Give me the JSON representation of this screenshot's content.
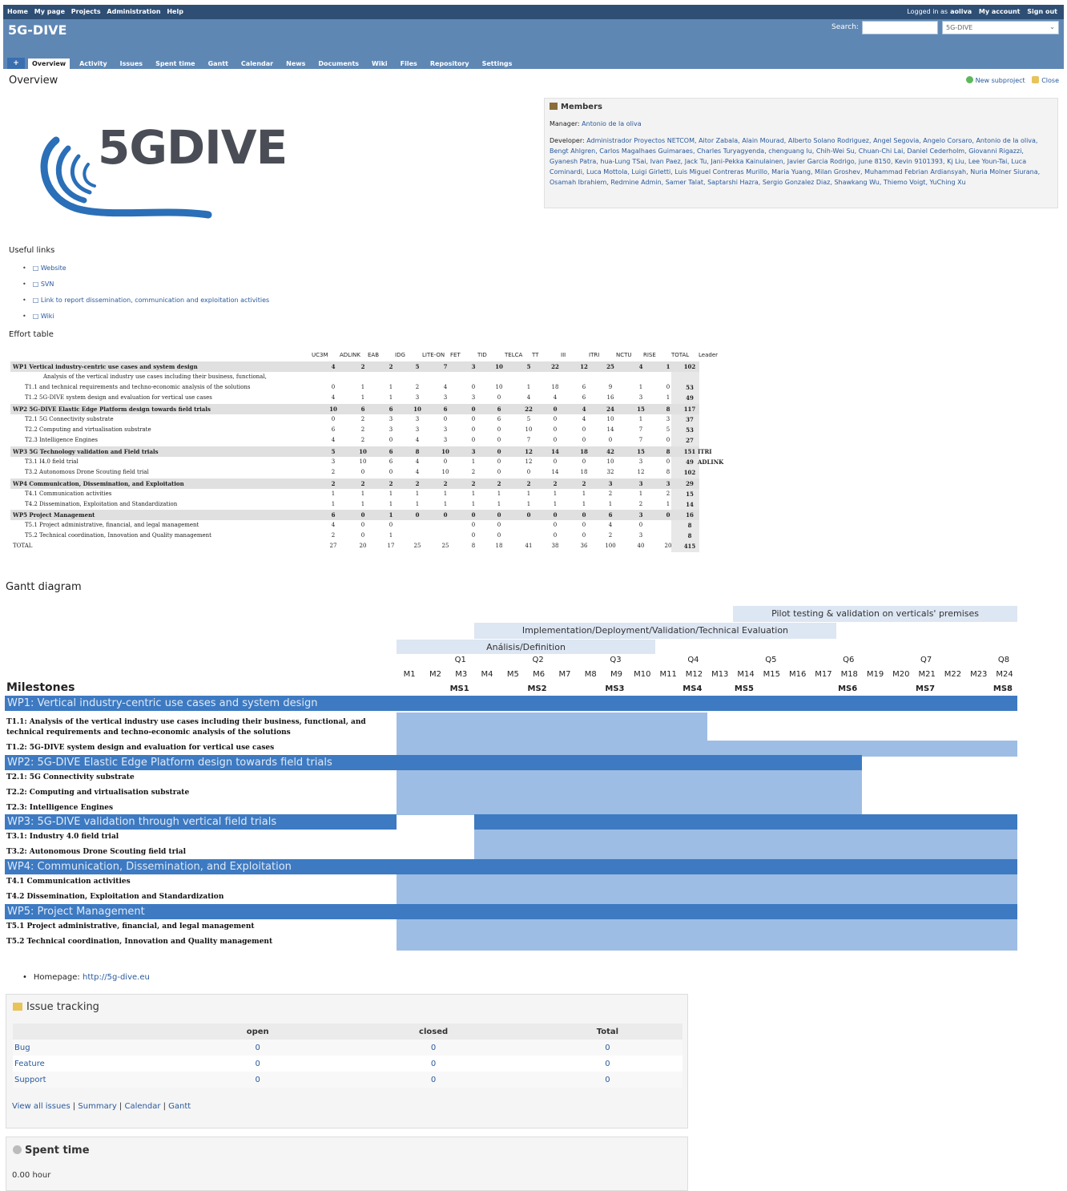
{
  "top_menu": {
    "items": [
      "Home",
      "My page",
      "Projects",
      "Administration",
      "Help"
    ],
    "logged_in_prefix": "Logged in as",
    "user": "aoliva",
    "my_account": "My account",
    "sign_out": "Sign out"
  },
  "header": {
    "title": "5G-DIVE",
    "search_label": "Search:",
    "jump_value": "5G-DIVE"
  },
  "tabs": [
    "Overview",
    "Activity",
    "Issues",
    "Spent time",
    "Gantt",
    "Calendar",
    "News",
    "Documents",
    "Wiki",
    "Files",
    "Repository",
    "Settings"
  ],
  "tab_new": "+",
  "page": {
    "title": "Overview",
    "new_subproject": "New subproject",
    "close": "Close"
  },
  "logo": {
    "text": "5GDIVE"
  },
  "members": {
    "title": "Members",
    "manager_label": "Manager:",
    "manager": "Antonio de la oliva",
    "developer_label": "Developer:",
    "developers": "Administrador Proyectos NETCOM, Aitor Zabala, Alain Mourad, Alberto Solano Rodriguez, Angel Segovia, Angelo Corsaro, Antonio de la oliva, Bengt Ahlgren, Carlos Magalhaes Guimaraes, Charles Turyagyenda, chenguang lu, Chih-Wei Su, Chuan-Chi Lai, Daniel Cederholm, Giovanni Rigazzi, Gyanesh Patra, hua-Lung TSai, Ivan Paez, Jack Tu, Jani-Pekka Kainulainen, Javier Garcia Rodrigo, june 8150, Kevin 9101393, Kj Liu, Lee Youn-Tai, Luca Cominardi, Luca Mottola, Luigi Girletti, Luis Miguel Contreras Murillo, Maria Yuang, Milan Groshev, Muhammad Febrian Ardiansyah, Nuria Molner Siurana, Osamah Ibrahiem, Redmine Admin, Samer Talat, Saptarshi Hazra, Sergio Gonzalez Diaz, Shawkang Wu, Thiemo Voigt, YuChing Xu"
  },
  "useful_links": {
    "title": "Useful links",
    "items": [
      "Website",
      "SVN",
      "Link to report dissemination, communication and exploitation activities",
      "Wiki"
    ]
  },
  "effort": {
    "title": "Effort table",
    "headers": [
      "UC3M",
      "ADLINK",
      "EAB",
      "IDG",
      "LITE-ON",
      "FET",
      "TID",
      "TELCA",
      "TT",
      "III",
      "ITRI",
      "NCTU",
      "RISE",
      "TOTAL",
      "Leader"
    ],
    "rows": [
      {
        "label": "WP1 Vertical industry-centric use cases and system design",
        "vals": [
          "4",
          "2",
          "2",
          "5",
          "7",
          "3",
          "10",
          "5",
          "22",
          "12",
          "25",
          "4",
          "1",
          "102"
        ],
        "leader": "",
        "wp": true
      },
      {
        "label": "Analysis of the vertical industry use cases including their business, functional,",
        "vals": [],
        "leader": "",
        "wp": false
      },
      {
        "label": "T1.1 and technical requirements and techno-economic analysis of the solutions",
        "vals": [
          "0",
          "1",
          "1",
          "2",
          "4",
          "0",
          "10",
          "1",
          "18",
          "6",
          "9",
          "1",
          "0",
          "53"
        ],
        "leader": "",
        "wp": false
      },
      {
        "label": "T1.2 5G-DIVE system design and evaluation for vertical use cases",
        "vals": [
          "4",
          "1",
          "1",
          "3",
          "3",
          "3",
          "0",
          "4",
          "4",
          "6",
          "16",
          "3",
          "1",
          "49"
        ],
        "leader": "",
        "wp": false
      },
      {
        "label": "WP2 5G-DIVE Elastic Edge Platform design towards field trials",
        "vals": [
          "10",
          "6",
          "6",
          "10",
          "6",
          "0",
          "6",
          "22",
          "0",
          "4",
          "24",
          "15",
          "8",
          "117"
        ],
        "leader": "",
        "wp": true
      },
      {
        "label": "T2.1 5G Connectivity substrate",
        "vals": [
          "0",
          "2",
          "3",
          "3",
          "0",
          "0",
          "6",
          "5",
          "0",
          "4",
          "10",
          "1",
          "3",
          "37"
        ],
        "leader": "",
        "wp": false
      },
      {
        "label": "T2.2 Computing and virtualisation substrate",
        "vals": [
          "6",
          "2",
          "3",
          "3",
          "3",
          "0",
          "0",
          "10",
          "0",
          "0",
          "14",
          "7",
          "5",
          "53"
        ],
        "leader": "",
        "wp": false
      },
      {
        "label": "T2.3 Intelligence Engines",
        "vals": [
          "4",
          "2",
          "0",
          "4",
          "3",
          "0",
          "0",
          "7",
          "0",
          "0",
          "0",
          "7",
          "0",
          "27"
        ],
        "leader": "",
        "wp": false
      },
      {
        "label": "WP3 5G Technology validation and Field trials",
        "vals": [
          "5",
          "10",
          "6",
          "8",
          "10",
          "3",
          "0",
          "12",
          "14",
          "18",
          "42",
          "15",
          "8",
          "151"
        ],
        "leader": "ITRI",
        "wp": true
      },
      {
        "label": "T3.1 I4.0 field trial",
        "vals": [
          "3",
          "10",
          "6",
          "4",
          "0",
          "1",
          "0",
          "12",
          "0",
          "0",
          "10",
          "3",
          "0",
          "49"
        ],
        "leader": "ADLINK",
        "wp": false
      },
      {
        "label": "T3.2 Autonomous Drone Scouting field trial",
        "vals": [
          "2",
          "0",
          "0",
          "4",
          "10",
          "2",
          "0",
          "0",
          "14",
          "18",
          "32",
          "12",
          "8",
          "102"
        ],
        "leader": "",
        "wp": false
      },
      {
        "label": "WP4 Communication, Dissemination, and Exploitation",
        "vals": [
          "2",
          "2",
          "2",
          "2",
          "2",
          "2",
          "2",
          "2",
          "2",
          "2",
          "3",
          "3",
          "3",
          "29"
        ],
        "leader": "",
        "wp": true
      },
      {
        "label": "T4.1 Communication activities",
        "vals": [
          "1",
          "1",
          "1",
          "1",
          "1",
          "1",
          "1",
          "1",
          "1",
          "1",
          "2",
          "1",
          "2",
          "15"
        ],
        "leader": "",
        "wp": false
      },
      {
        "label": "T4.2 Dissemination, Exploitation and Standardization",
        "vals": [
          "1",
          "1",
          "1",
          "1",
          "1",
          "1",
          "1",
          "1",
          "1",
          "1",
          "1",
          "2",
          "1",
          "14"
        ],
        "leader": "",
        "wp": false
      },
      {
        "label": "WP5 Project Management",
        "vals": [
          "6",
          "0",
          "1",
          "0",
          "0",
          "0",
          "0",
          "0",
          "0",
          "0",
          "6",
          "3",
          "0",
          "16"
        ],
        "leader": "",
        "wp": true
      },
      {
        "label": "T5.1 Project administrative, financial, and legal management",
        "vals": [
          "4",
          "0",
          "0",
          "",
          "",
          "0",
          "0",
          "",
          "0",
          "0",
          "4",
          "0",
          "",
          "8"
        ],
        "leader": "",
        "wp": false
      },
      {
        "label": "T5.2 Technical coordination, Innovation and Quality management",
        "vals": [
          "2",
          "0",
          "1",
          "",
          "",
          "0",
          "0",
          "",
          "0",
          "0",
          "2",
          "3",
          "",
          "8"
        ],
        "leader": "",
        "wp": false
      },
      {
        "label": "TOTAL",
        "vals": [
          "27",
          "20",
          "17",
          "25",
          "25",
          "8",
          "18",
          "41",
          "38",
          "36",
          "100",
          "40",
          "20",
          "415"
        ],
        "leader": "",
        "wp": false
      }
    ]
  },
  "gantt": {
    "title": "Gantt diagram",
    "phases": [
      {
        "label": "Pilot testing & validation on verticals' premises",
        "start": 14,
        "end": 24,
        "row": 0
      },
      {
        "label": "Implementation/Deployment/Validation/Technical Evaluation",
        "start": 4,
        "end": 17,
        "row": 1
      },
      {
        "label": "Análisis/Definition",
        "start": 1,
        "end": 10,
        "row": 2
      }
    ],
    "quarters": [
      "Q1",
      "Q2",
      "Q3",
      "Q4",
      "Q5",
      "Q6",
      "Q7",
      "Q8"
    ],
    "months": [
      "M1",
      "M2",
      "M3",
      "M4",
      "M5",
      "M6",
      "M7",
      "M8",
      "M9",
      "M10",
      "M11",
      "M12",
      "M13",
      "M14",
      "M15",
      "M16",
      "M17",
      "M18",
      "M19",
      "M20",
      "M21",
      "M22",
      "M23",
      "M24"
    ],
    "milestones_label": "Milestones",
    "milestones": [
      {
        "label": "MS1",
        "month": 3
      },
      {
        "label": "MS2",
        "month": 6
      },
      {
        "label": "MS3",
        "month": 9
      },
      {
        "label": "MS4",
        "month": 12
      },
      {
        "label": "MS5",
        "month": 14
      },
      {
        "label": "MS6",
        "month": 18
      },
      {
        "label": "MS7",
        "month": 21
      },
      {
        "label": "MS8",
        "month": 24
      }
    ],
    "wps": [
      {
        "label": "WP1: Vertical industry-centric use cases and system design",
        "start": 1,
        "end": 24,
        "tasks": [
          {
            "label": "T1.1: Analysis of the vertical industry use cases including their business, functional, and technical requirements and techno-economic analysis of the solutions",
            "start": 1,
            "end": 12
          },
          {
            "label": "T1.2: 5G-DIVE system design and evaluation for vertical use cases",
            "start": 1,
            "end": 24
          }
        ]
      },
      {
        "label": "WP2: 5G-DIVE Elastic Edge Platform design towards field trials",
        "start": 1,
        "end": 18,
        "tasks": [
          {
            "label": "T2.1: 5G Connectivity substrate",
            "start": 1,
            "end": 18
          },
          {
            "label": "T2.2: Computing and virtualisation substrate",
            "start": 1,
            "end": 18
          },
          {
            "label": "T2.3: Intelligence Engines",
            "start": 1,
            "end": 18
          }
        ]
      },
      {
        "label": "WP3: 5G-DIVE validation through vertical field trials",
        "start": 4,
        "end": 24,
        "tasks": [
          {
            "label": "T3.1: Industry 4.0 field trial",
            "start": 4,
            "end": 24
          },
          {
            "label": "T3.2: Autonomous Drone Scouting field trial",
            "start": 4,
            "end": 24
          }
        ]
      },
      {
        "label": "WP4: Communication, Dissemination, and Exploitation",
        "start": 1,
        "end": 24,
        "tasks": [
          {
            "label": "T4.1 Communication activities",
            "start": 1,
            "end": 24
          },
          {
            "label": "T4.2 Dissemination, Exploitation and Standardization",
            "start": 1,
            "end": 24
          }
        ]
      },
      {
        "label": "WP5: Project Management",
        "start": 1,
        "end": 24,
        "tasks": [
          {
            "label": "T5.1 Project administrative, financial, and legal management",
            "start": 1,
            "end": 24
          },
          {
            "label": "T5.2 Technical coordination, Innovation and Quality management",
            "start": 1,
            "end": 24
          }
        ]
      }
    ]
  },
  "homepage": {
    "label": "Homepage:",
    "url": "http://5g-dive.eu"
  },
  "issues": {
    "title": "Issue tracking",
    "headers": [
      "",
      "open",
      "closed",
      "Total"
    ],
    "rows": [
      {
        "tracker": "Bug",
        "open": "0",
        "closed": "0",
        "total": "0"
      },
      {
        "tracker": "Feature",
        "open": "0",
        "closed": "0",
        "total": "0"
      },
      {
        "tracker": "Support",
        "open": "0",
        "closed": "0",
        "total": "0"
      }
    ],
    "links": [
      "View all issues",
      "Summary",
      "Calendar",
      "Gantt"
    ]
  },
  "spent_time": {
    "title": "Spent time",
    "value": "0.00 hour"
  },
  "colors": {
    "top_bar": "#2e4e74",
    "header": "#5f87b4",
    "wp_bar": "#3d7ac2",
    "task_bar": "#9dbde4",
    "phase": "#dde6f3",
    "logo_wave": "#2a6fb8"
  }
}
